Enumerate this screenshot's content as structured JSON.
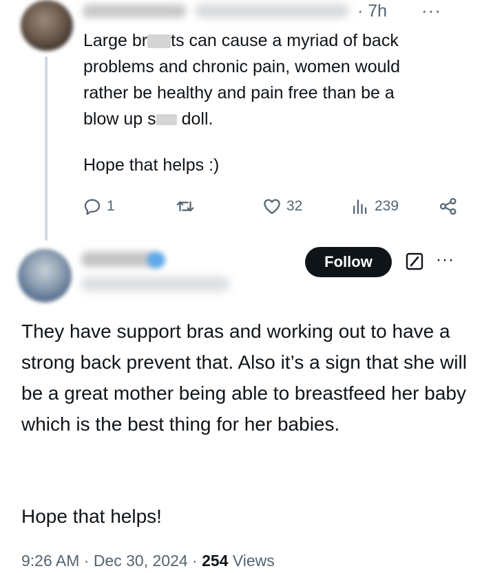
{
  "reply": {
    "time": "· 7h",
    "more": "···",
    "text_line1_a": "Large br",
    "text_line1_b": "ts can cause a myriad of back",
    "text_line2": "problems and chronic pain, women would",
    "text_line3": "rather be healthy and pain free than be a",
    "text_line4_a": "blow up s",
    "text_line4_b": "doll.",
    "text_para2": "Hope that helps :)",
    "reply_count": "1",
    "like_count": "32",
    "view_count": "239"
  },
  "tweet": {
    "follow_label": "Follow",
    "more": "···",
    "text": "They have support bras and working out to have a strong back prevent that. Also it’s a sign that she will be a great mother being able to breastfeed her baby which is the best thing for her babies.",
    "text_para2": "Hope that helps!",
    "timestamp": "9:26 AM · Dec 30, 2024 · ",
    "views_count": "254",
    "views_label": " Views"
  }
}
